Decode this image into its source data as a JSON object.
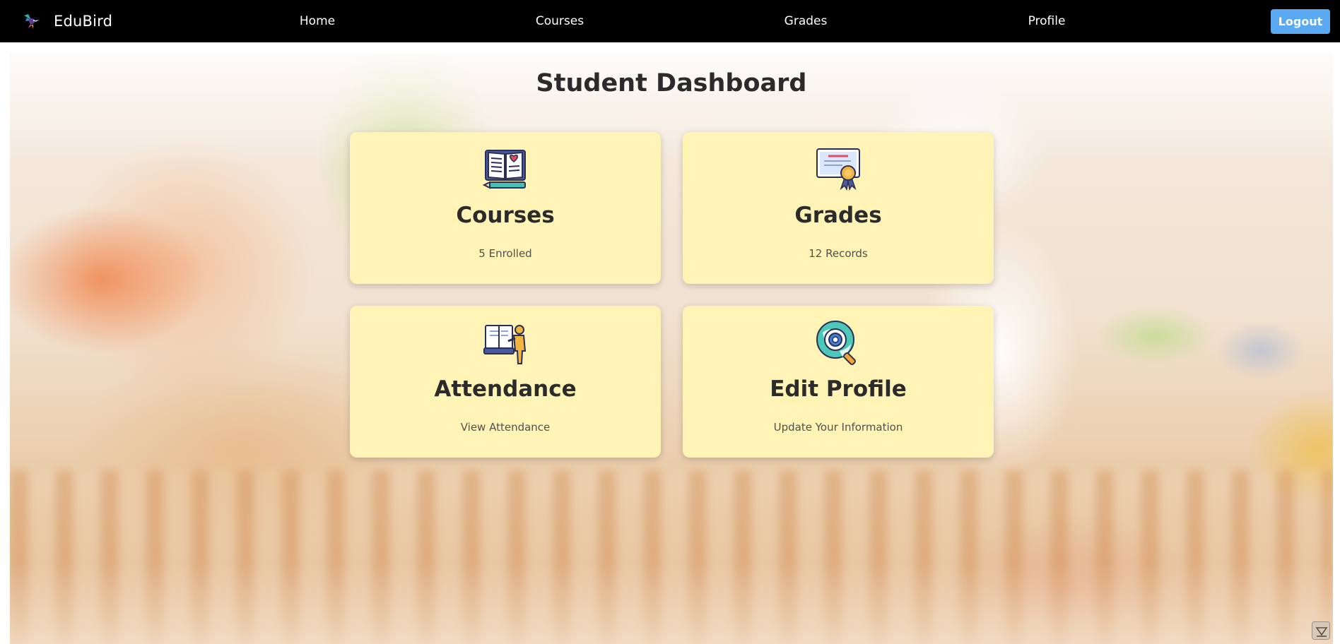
{
  "navbar": {
    "brand_name": "EduBird",
    "links": [
      {
        "label": "Home"
      },
      {
        "label": "Courses"
      },
      {
        "label": "Grades"
      },
      {
        "label": "Profile"
      }
    ],
    "logout_label": "Logout"
  },
  "main": {
    "title": "Student Dashboard",
    "cards": [
      {
        "title": "Courses",
        "subtitle": "5 Enrolled",
        "icon": "open-book-icon"
      },
      {
        "title": "Grades",
        "subtitle": "12 Records",
        "icon": "certificate-icon"
      },
      {
        "title": "Attendance",
        "subtitle": "View Attendance",
        "icon": "teacher-board-icon"
      },
      {
        "title": "Edit Profile",
        "subtitle": "Update Your Information",
        "icon": "settings-search-icon"
      }
    ]
  },
  "colors": {
    "navbar_bg": "#000000",
    "logout_bg": "#5aa9f2",
    "card_bg": "#fff3b5",
    "title_text": "#2b2b2b"
  }
}
